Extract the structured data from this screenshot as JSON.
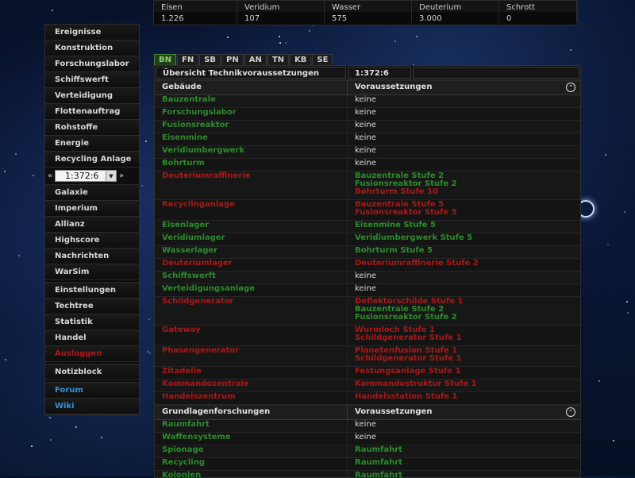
{
  "resources": {
    "headers": [
      "Eisen",
      "Veridium",
      "Wasser",
      "Deuterium",
      "Schrott"
    ],
    "values": [
      "1.226",
      "107",
      "575",
      "3.000",
      "0"
    ]
  },
  "menu": {
    "items_top": [
      "Ereignisse",
      "Konstruktion",
      "Forschungslabor",
      "Schiffswerft",
      "Verteidigung",
      "Flottenauftrag",
      "Rohstoffe",
      "Energie",
      "Recycling Anlage"
    ],
    "planet_prev": "«",
    "planet_next": "»",
    "planet_value": "1:372:6",
    "items_mid": [
      "Galaxie",
      "Imperium",
      "Allianz",
      "Highscore",
      "Nachrichten",
      "WarSim"
    ],
    "items_bottom": [
      "Einstellungen",
      "Techtree",
      "Statistik",
      "Handel"
    ],
    "logout": "Ausloggen",
    "notes": "Notizblock",
    "forum": "Forum",
    "wiki": "Wiki"
  },
  "tabs": [
    "BN",
    "FN",
    "SB",
    "PN",
    "AN",
    "TN",
    "KB",
    "SE"
  ],
  "overview": {
    "title": "Übersicht Technikvoraussetzungen",
    "coords": "1:372:6"
  },
  "buildings_header": {
    "col1": "Gebäude",
    "col2": "Voraussetzungen"
  },
  "buildings": [
    {
      "name": "Bauzentrale",
      "color": "g",
      "req": [
        {
          "t": "keine",
          "c": "w"
        }
      ]
    },
    {
      "name": "Forschungslabor",
      "color": "g",
      "req": [
        {
          "t": "keine",
          "c": "w"
        }
      ]
    },
    {
      "name": "Fusionsreaktor",
      "color": "g",
      "req": [
        {
          "t": "keine",
          "c": "w"
        }
      ]
    },
    {
      "name": "Eisenmine",
      "color": "g",
      "req": [
        {
          "t": "keine",
          "c": "w"
        }
      ]
    },
    {
      "name": "Veridiumbergwerk",
      "color": "g",
      "req": [
        {
          "t": "keine",
          "c": "w"
        }
      ]
    },
    {
      "name": "Bohrturm",
      "color": "g",
      "req": [
        {
          "t": "keine",
          "c": "w"
        }
      ]
    },
    {
      "name": "Deuteriumraffinerie",
      "color": "r",
      "req": [
        {
          "t": "Bauzentrale Stufe 2",
          "c": "g"
        },
        {
          "t": "Fusionsreaktor Stufe 2",
          "c": "g"
        },
        {
          "t": "Bohrturm Stufe 10",
          "c": "r"
        }
      ]
    },
    {
      "name": "Recyclinganlage",
      "color": "r",
      "req": [
        {
          "t": "Bauzentrale Stufe 5",
          "c": "r"
        },
        {
          "t": "Fusionsreaktor Stufe 5",
          "c": "r"
        }
      ]
    },
    {
      "name": "Eisenlager",
      "color": "g",
      "req": [
        {
          "t": "Eisenmine Stufe 5",
          "c": "g"
        }
      ]
    },
    {
      "name": "Veridiumlager",
      "color": "g",
      "req": [
        {
          "t": "Veridiumbergwerk Stufe 5",
          "c": "g"
        }
      ]
    },
    {
      "name": "Wasserlager",
      "color": "g",
      "req": [
        {
          "t": "Bohrturm Stufe 5",
          "c": "g"
        }
      ]
    },
    {
      "name": "Deuteriumlager",
      "color": "r",
      "req": [
        {
          "t": "Deuteriumraffinerie Stufe 2",
          "c": "r"
        }
      ]
    },
    {
      "name": "Schiffswerft",
      "color": "g",
      "req": [
        {
          "t": "keine",
          "c": "w"
        }
      ]
    },
    {
      "name": "Verteidigungsanlage",
      "color": "g",
      "req": [
        {
          "t": "keine",
          "c": "w"
        }
      ]
    },
    {
      "name": "Schildgenerator",
      "color": "r",
      "req": [
        {
          "t": "Deflektorschilde Stufe 1",
          "c": "r"
        },
        {
          "t": "Bauzentrale Stufe 2",
          "c": "g"
        },
        {
          "t": "Fusionsreaktor Stufe 2",
          "c": "g"
        }
      ]
    },
    {
      "name": "Gateway",
      "color": "r",
      "req": [
        {
          "t": "Wurmloch Stufe 1",
          "c": "r"
        },
        {
          "t": "Schildgenerator Stufe 1",
          "c": "r"
        }
      ]
    },
    {
      "name": "Phasengenerator",
      "color": "r",
      "req": [
        {
          "t": "Planetenfusion Stufe 1",
          "c": "r"
        },
        {
          "t": "Schildgenerator Stufe 1",
          "c": "r"
        }
      ]
    },
    {
      "name": "Zitadelle",
      "color": "r",
      "req": [
        {
          "t": "Festungsanlage Stufe 1",
          "c": "r"
        }
      ]
    },
    {
      "name": "Kommandozentrale",
      "color": "r",
      "req": [
        {
          "t": "Kommandostruktur Stufe 1",
          "c": "r"
        }
      ]
    },
    {
      "name": "Handelszentrum",
      "color": "r",
      "req": [
        {
          "t": "Handelsstation Stufe 1",
          "c": "r"
        }
      ]
    }
  ],
  "research_header": {
    "col1": "Grundlagenforschungen",
    "col2": "Voraussetzungen"
  },
  "research": [
    {
      "name": "Raumfahrt",
      "color": "g",
      "req": [
        {
          "t": "keine",
          "c": "w"
        }
      ]
    },
    {
      "name": "Waffensysteme",
      "color": "g",
      "req": [
        {
          "t": "keine",
          "c": "w"
        }
      ]
    },
    {
      "name": "Spionage",
      "color": "g",
      "req": [
        {
          "t": "Raumfahrt",
          "c": "g"
        }
      ]
    },
    {
      "name": "Recycling",
      "color": "g",
      "req": [
        {
          "t": "Raumfahrt",
          "c": "g"
        }
      ]
    },
    {
      "name": "Kolonien",
      "color": "g",
      "req": [
        {
          "t": "Raumfahrt",
          "c": "g"
        }
      ]
    }
  ],
  "colors": {
    "met": "#2c8c2c",
    "unmet": "#a81818",
    "active_tab": "#1f3f18",
    "link": "#3a8fd8"
  }
}
